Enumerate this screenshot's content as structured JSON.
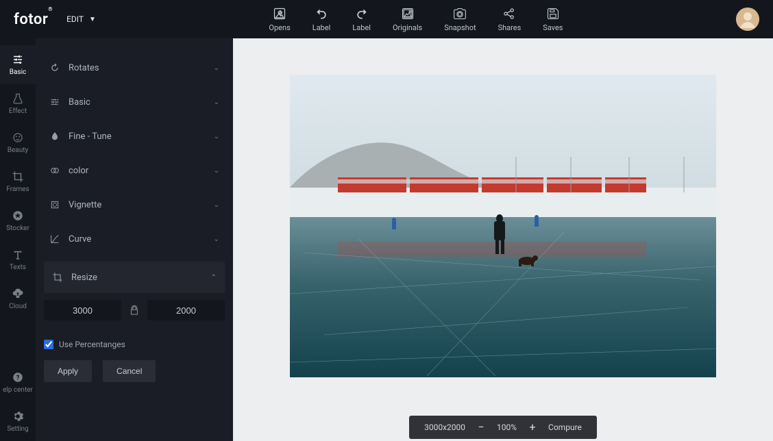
{
  "logo": "fotor",
  "edit_menu": {
    "label": "EDIT"
  },
  "toolbar": [
    {
      "id": "opens",
      "label": "Opens",
      "icon": "image-plus"
    },
    {
      "id": "label1",
      "label": "Label",
      "icon": "undo"
    },
    {
      "id": "label2",
      "label": "Label",
      "icon": "redo"
    },
    {
      "id": "originals",
      "label": "Originals",
      "icon": "image"
    },
    {
      "id": "snapshot",
      "label": "Snapshot",
      "icon": "camera"
    },
    {
      "id": "shares",
      "label": "Shares",
      "icon": "share"
    },
    {
      "id": "saves",
      "label": "Saves",
      "icon": "save"
    }
  ],
  "nav": [
    {
      "id": "basic",
      "label": "Basic",
      "active": true
    },
    {
      "id": "effect",
      "label": "Effect"
    },
    {
      "id": "beauty",
      "label": "Beauty"
    },
    {
      "id": "frames",
      "label": "Frames"
    },
    {
      "id": "stocker",
      "label": "Stocker"
    },
    {
      "id": "texts",
      "label": "Texts"
    },
    {
      "id": "cloud",
      "label": "Cloud"
    }
  ],
  "nav_footer": [
    {
      "id": "help",
      "label": "elp center"
    },
    {
      "id": "setting",
      "label": "Setting"
    }
  ],
  "panel": {
    "rows": [
      {
        "id": "rotates",
        "label": "Rotates"
      },
      {
        "id": "basic",
        "label": "Basic"
      },
      {
        "id": "finetune",
        "label": "Fine  -  Tune"
      },
      {
        "id": "color",
        "label": "color"
      },
      {
        "id": "vignette",
        "label": "Vignette"
      },
      {
        "id": "curve",
        "label": "Curve"
      }
    ],
    "resize": {
      "label": "Resize",
      "width": "3000",
      "height": "2000",
      "use_percentages_label": "Use Percentanges",
      "use_percentages": true,
      "apply": "Apply",
      "cancel": "Cancel"
    }
  },
  "status": {
    "dimensions": "3000x2000",
    "zoom": "100%",
    "compare": "Compure"
  }
}
